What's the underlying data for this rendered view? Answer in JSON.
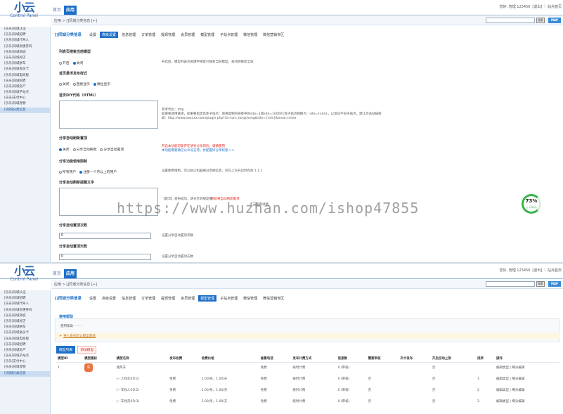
{
  "app": {
    "logo_text": "Control Panel",
    "logo_mark": "小云"
  },
  "topnav": {
    "home": "首页",
    "active": "应用"
  },
  "toplinks": {
    "greeting": "您好, 管理 123456",
    "logout": "[退出]",
    "site_home": "站点首页"
  },
  "breadcrumb": "应用 > []同城分类信息 [+]",
  "search_button": "搜索",
  "map_button": "MAP",
  "sidebar": {
    "items": [
      "[乐乐]同城认证",
      "[乐乐]同城招聘",
      "[乐乐]同城代驾人",
      "[乐乐]同城优惠券码",
      "[乐乐]同城商城",
      "[乐乐]同城好店",
      "[乐乐]同城拼车",
      "[乐乐]同城会员卡",
      "[乐乐]同城电商版",
      "[乐乐]同城招聘",
      "[乐乐]同城房产",
      "[乐乐]同城子站点",
      "[乐乐]支付中心",
      "[乐乐]同城宠物",
      "[]同城分类信息"
    ]
  },
  "section_title": "[]同城分类信息",
  "tabs": [
    "设置",
    "高级设置",
    "信息管理",
    "订单管理",
    "提现管理",
    "会员管理",
    "模型管理",
    "子站点管理",
    "微信管理",
    "微信营销专区"
  ],
  "settings": {
    "model_title": "列表页搜索当前模型",
    "model_opts": [
      "开启",
      "关闭"
    ],
    "model_hint": "开启后，模型列表页关键字搜索只搜索当前模型，关闭则搜索全站",
    "float_title": "首页悬浮发布样式",
    "float_opts": [
      "关闭",
      "直接显示",
      "弹出显示"
    ],
    "diy_title": "首页DIY代码（HTML）",
    "diy_hint1": "参考代码：http",
    "diy_hint2": "如果要调用链接，如果要指定具体子站点：请将复制的链接中的site=1或site=100001等子站点替换为：site={site}，以适应不同子站点，默认为总站链接",
    "diy_hint3": "如：http://www.xxxxxx.com/plugin.php?id=tom_tongcheng&site={site}&mod=index",
    "share_title": "分享自动刷新置顶",
    "share_opts": [
      "关闭",
      "分享自动刷新",
      "分享自动置顶"
    ],
    "share_hint_red": "开启本功能可能存在诱导分享风险，谨慎使用",
    "share_hint_blue": "本功能需要微信公众号支持，并配置好分享权限 >>",
    "limit_title": "分享功能使用限制",
    "limit_opts": [
      "所有用户",
      "注册一个月以上的用户"
    ],
    "limit_hint": "设置使用限制，可以防止机器刷分享刷信息，仅在上方开启时有效 1.1.1",
    "prompt_title": "分享自动刷新提醒文字",
    "prompt_hint_a": "【提示】发布成功，请分享到朋友圈",
    "prompt_hint_b": "系统将自动刷新置顶",
    "prompt_hint_c": "点击查看详情",
    "count_title": "分享自动置顶次数",
    "count_value": "0",
    "count_hint": "设置分享自动置顶次数",
    "days_title": "分享自动置顶天数",
    "days_value": "0",
    "days_hint": "设置分享自动置顶天数"
  },
  "watermark": "https://www.huzhan.com/ishop47855",
  "gauge": {
    "value": "73%",
    "sub": "+ 0.3K/s"
  },
  "models_page": {
    "help_title": "使用帮助",
    "help_line": "使用帮助 - - - -",
    "help_link": "导入系统默认模型数据",
    "subtab_list": "模型列表",
    "subtab_add": "添加模型",
    "headers": [
      "模型ID",
      "模型图标",
      "模型名称",
      "发布收费",
      "收费价格",
      "查看电话",
      "发布计费方式",
      "信息数",
      "需要审核",
      "次卡发布",
      "开启自动上架",
      "排序",
      "操作"
    ],
    "parent": {
      "id": "1",
      "icon": "车",
      "name": "顺风车",
      "phone": "免费",
      "billing": "按时计费",
      "count": "0 (审核)",
      "review": "否",
      "card": "",
      "auto": "否",
      "sort": "",
      "ops": "编辑类型 | 细分编辑"
    },
    "children": [
      {
        "name": "|-- 人找车(ID:1)",
        "fee": "免费",
        "price": "1.00/条，1.00/天",
        "phone": "免费",
        "billing": "按时计费",
        "count": "0 (审核)",
        "review": "否",
        "auto": "否",
        "sort": "1",
        "ops": "编辑类型 | 细分编辑"
      },
      {
        "name": "|-- 车找人(ID:2)",
        "fee": "免费",
        "price": "1.00/条，1.00/天",
        "phone": "免费",
        "billing": "按时计费",
        "count": "0 (审核)",
        "review": "否",
        "auto": "否",
        "sort": "2",
        "ops": "编辑类型 | 细分编辑"
      },
      {
        "name": "|-- 车找货(ID:3)",
        "fee": "免费",
        "price": "1.00/条，1.00/天",
        "phone": "免费",
        "billing": "按时计费",
        "count": "0 (审核)",
        "review": "否",
        "auto": "否",
        "sort": "3",
        "ops": "编辑类型 | 细分编辑"
      }
    ]
  },
  "colors": {
    "accent": "#1e6fc7",
    "warning": "#e0261e",
    "ok": "#2f9b2f"
  }
}
